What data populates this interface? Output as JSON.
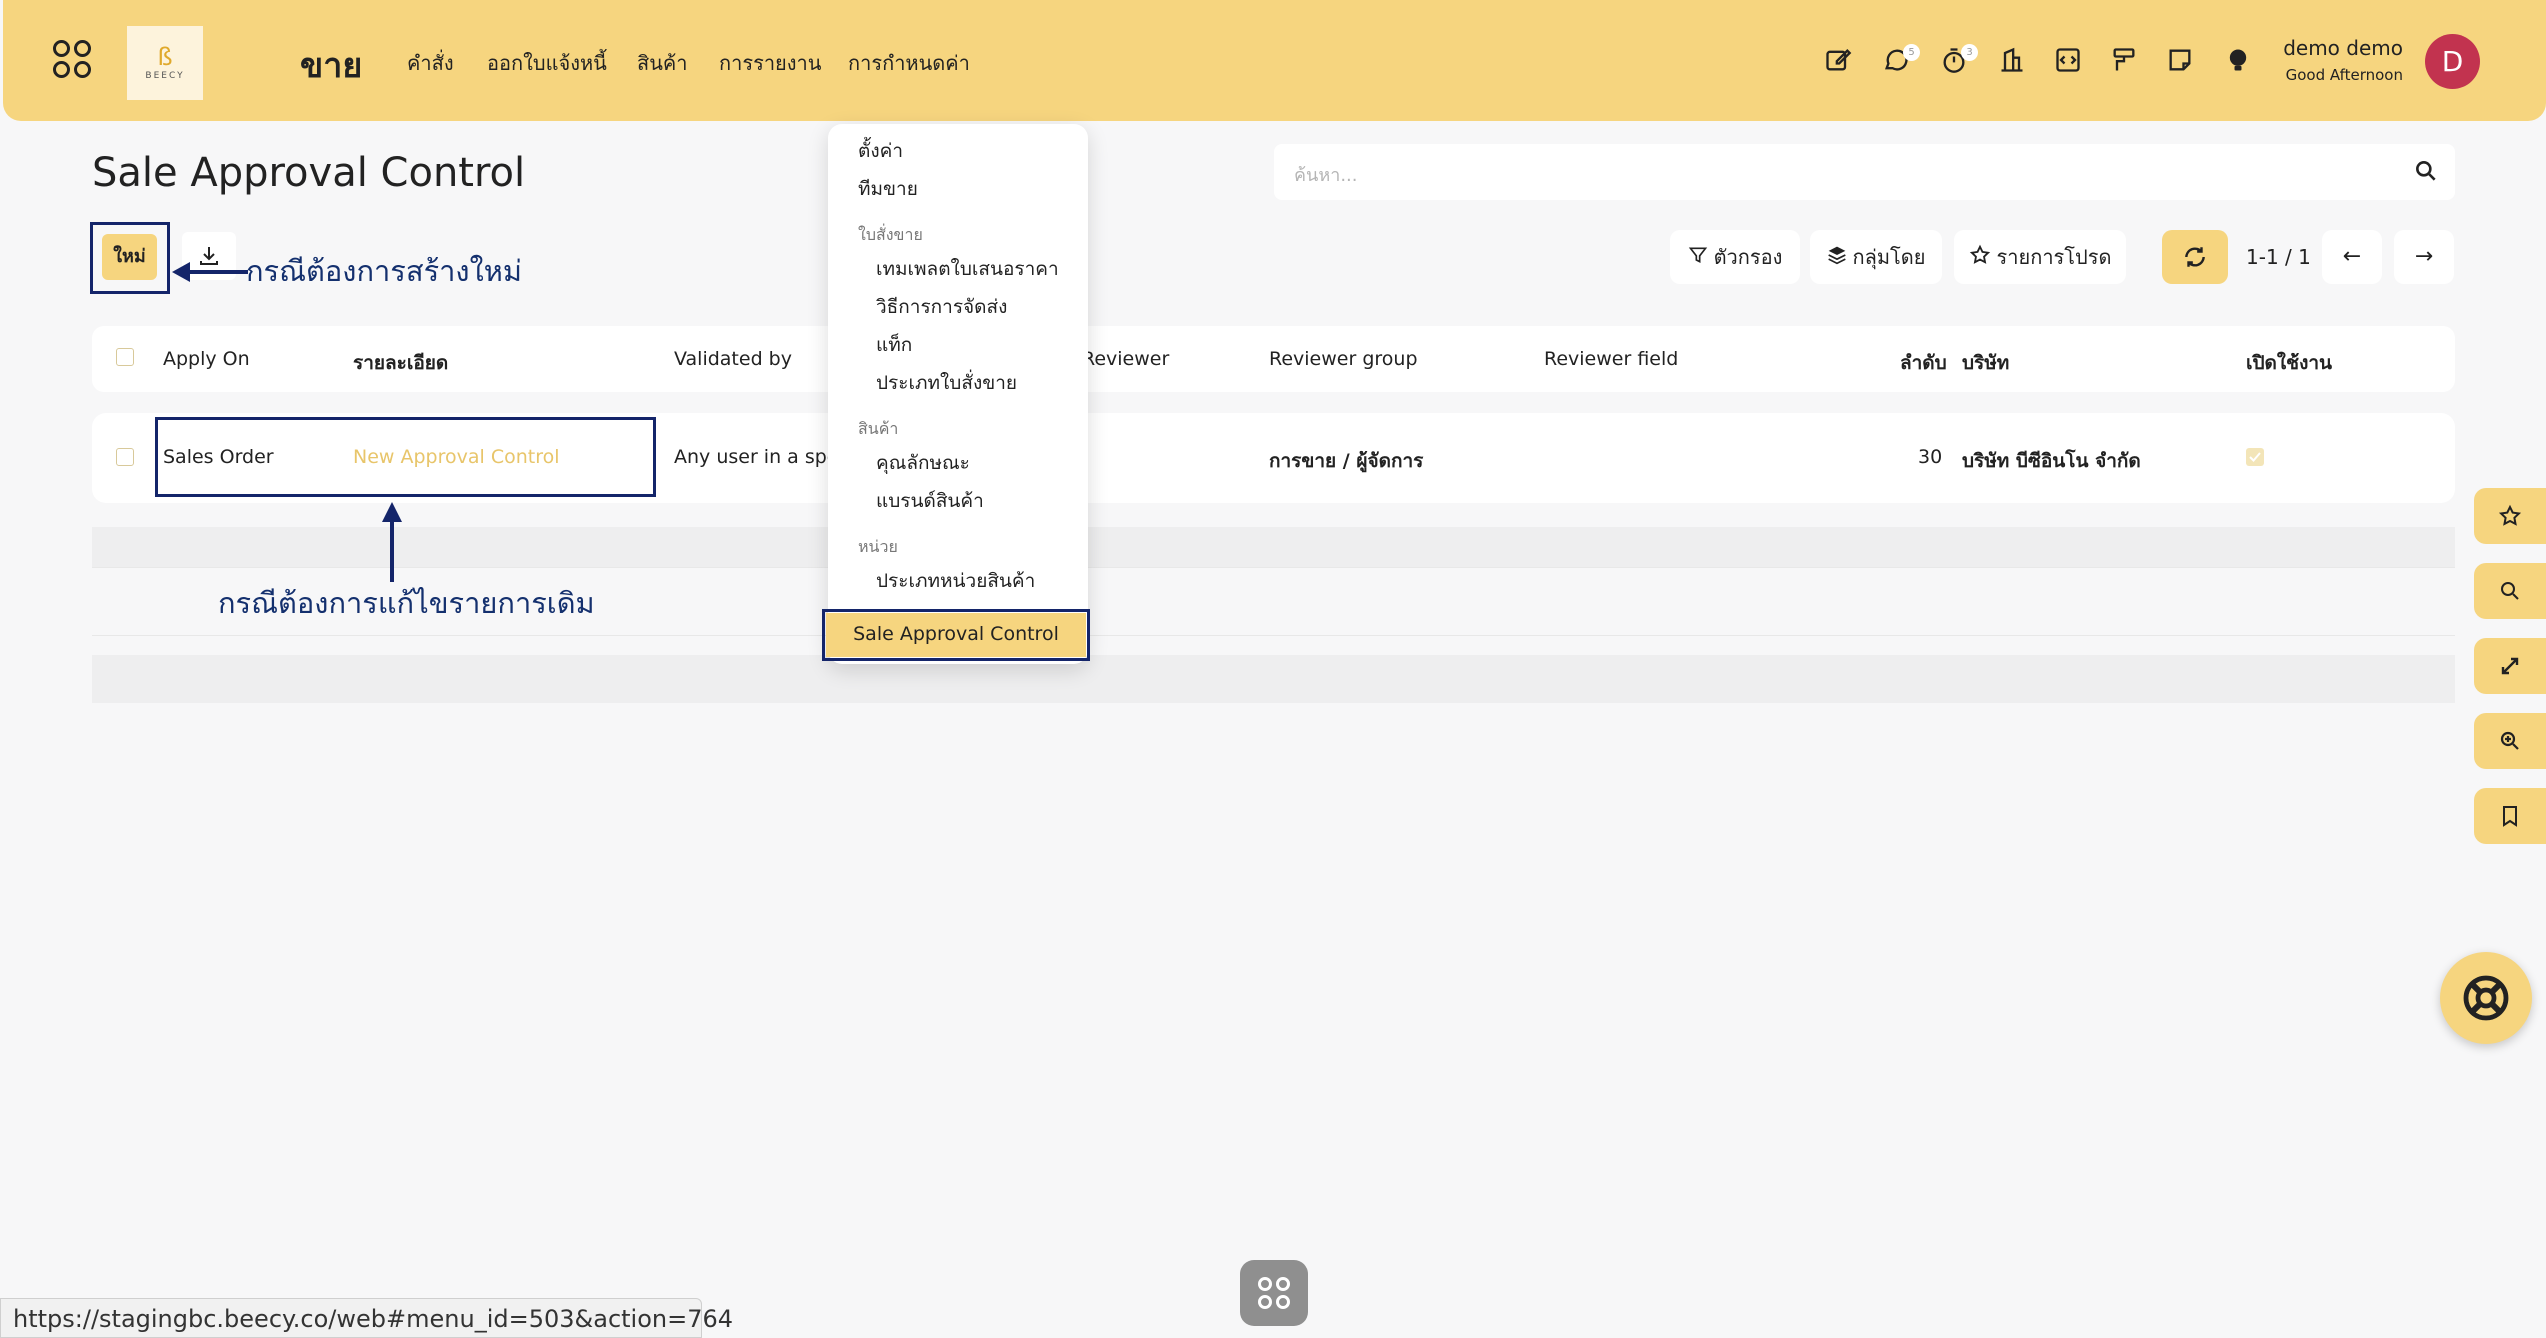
{
  "topbar": {
    "app_title": "ขาย",
    "logo_text": "BEECY",
    "menu": [
      "คำสั่ง",
      "ออกใบแจ้งหนี้",
      "สินค้า",
      "การรายงาน",
      "การกำหนดค่า"
    ],
    "badges": {
      "chat": "5",
      "timer": "3"
    },
    "user_name": "demo demo",
    "greeting": "Good Afternoon",
    "avatar_letter": "D"
  },
  "page": {
    "title": "Sale Approval Control",
    "search_placeholder": "ค้นหา...",
    "new_button": "ใหม่",
    "filter_label": "ตัวกรอง",
    "groupby_label": "กลุ่มโดย",
    "favorites_label": "รายการโปรด",
    "pager": "1-1 / 1"
  },
  "annotations": {
    "create_new": "กรณีต้องการสร้างใหม่",
    "edit_existing": "กรณีต้องการแก้ไขรายการเดิม"
  },
  "table": {
    "headers": {
      "apply_on": "Apply On",
      "detail": "รายละเอียด",
      "validated_by": "Validated by",
      "reviewer": "Reviewer",
      "reviewer_group": "Reviewer group",
      "reviewer_field": "Reviewer field",
      "sequence": "ลำดับ",
      "company": "บริษัท",
      "active": "เปิดใช้งาน"
    },
    "rows": [
      {
        "apply_on": "Sales Order",
        "detail": "New Approval Control",
        "validated_by": "Any user in a spe",
        "reviewer_group": "การขาย / ผู้จัดการ",
        "sequence": "30",
        "company": "บริษัท บีซีอินโน จำกัด",
        "active": true
      }
    ]
  },
  "dropdown": {
    "items": [
      {
        "type": "item",
        "label": "ตั้งค่า"
      },
      {
        "type": "item",
        "label": "ทีมขาย"
      },
      {
        "type": "section",
        "label": "ใบสั่งขาย"
      },
      {
        "type": "subitem",
        "label": "เทมเพลตใบเสนอราคา"
      },
      {
        "type": "subitem",
        "label": "วิธีการการจัดส่ง"
      },
      {
        "type": "subitem",
        "label": "แท็ก"
      },
      {
        "type": "subitem",
        "label": "ประเภทใบสั่งขาย"
      },
      {
        "type": "section",
        "label": "สินค้า"
      },
      {
        "type": "subitem",
        "label": "คุณลักษณะ"
      },
      {
        "type": "subitem",
        "label": "แบรนด์สินค้า"
      },
      {
        "type": "section",
        "label": "หน่วย"
      },
      {
        "type": "subitem",
        "label": "ประเภทหน่วยสินค้า"
      }
    ],
    "selected": "Sale Approval Control"
  },
  "statusbar": {
    "url": "https://stagingbc.beecy.co/web#menu_id=503&action=764"
  },
  "colors": {
    "accent": "#f6d57f",
    "annotation": "#14256a",
    "avatar": "#c2334f",
    "link": "#e8c56a"
  }
}
